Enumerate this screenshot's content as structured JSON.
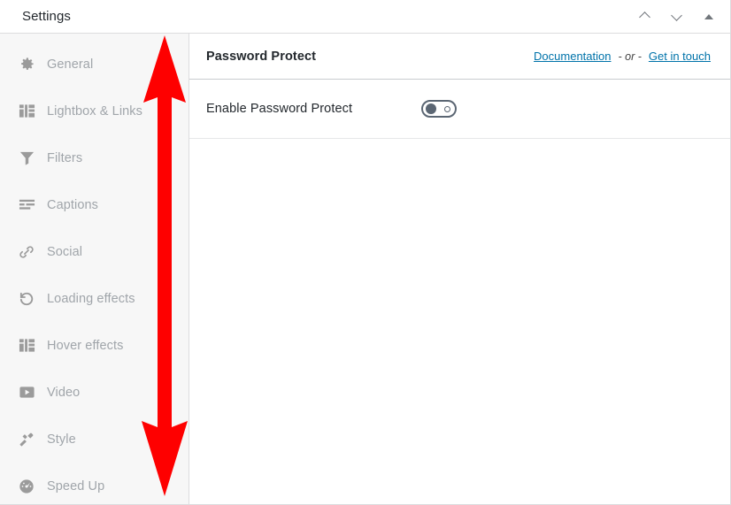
{
  "window": {
    "title": "Settings",
    "controls": [
      {
        "name": "collapse-up",
        "glyph": "chevron-up"
      },
      {
        "name": "expand-down",
        "glyph": "chevron-down"
      },
      {
        "name": "toggle-panel",
        "glyph": "triangle-up"
      }
    ]
  },
  "sidebar": {
    "items": [
      {
        "label": "General",
        "icon": "gear-icon"
      },
      {
        "label": "Lightbox & Links",
        "icon": "layout-icon"
      },
      {
        "label": "Filters",
        "icon": "funnel-icon"
      },
      {
        "label": "Captions",
        "icon": "text-lines-icon"
      },
      {
        "label": "Social",
        "icon": "link-chain-icon"
      },
      {
        "label": "Loading effects",
        "icon": "refresh-circle-icon"
      },
      {
        "label": "Hover effects",
        "icon": "layout-icon"
      },
      {
        "label": "Video",
        "icon": "play-button-icon"
      },
      {
        "label": "Style",
        "icon": "brush-icon"
      },
      {
        "label": "Speed Up",
        "icon": "speedometer-icon"
      }
    ]
  },
  "panel": {
    "title": "Password Protect",
    "documentation_link": "Documentation",
    "separator": "- or -",
    "contact_link": "Get in touch",
    "rows": [
      {
        "label": "Enable Password Protect",
        "control": "toggle",
        "state": "off"
      }
    ]
  },
  "annotation": {
    "type": "double-arrow",
    "color": "#fe0000",
    "direction": "vertical"
  },
  "colors": {
    "link": "#0073aa",
    "sidebar_bg": "#f7f7f7",
    "text_primary": "#23282d",
    "text_muted": "#a0a5aa",
    "border": "#dcdcde",
    "toggle": "#5b6673",
    "annotation": "#fe0000"
  }
}
